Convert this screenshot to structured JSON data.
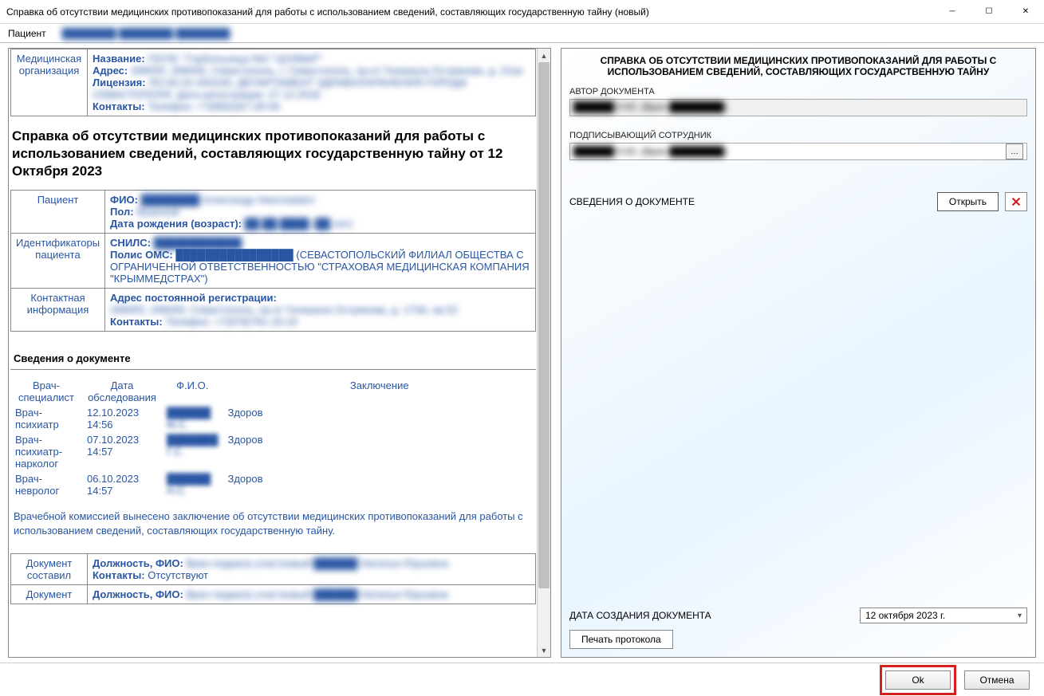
{
  "window": {
    "title": "Справка об отсутствии медицинских противопоказаний для работы с использованием сведений, составляющих государственную тайну (новый)"
  },
  "patient_bar": {
    "label": "Пациент",
    "name": "████████ ████████ ████████"
  },
  "org": {
    "section_label": "Медицинская\nорганизация",
    "name_label": "Название:",
    "name_value": "ГБУЗС \"Горбольница №5 \"ЦОЗМиР\"",
    "addr_label": "Адрес:",
    "addr_value": "299055, 299000, Севастополь, г. Севастополь, пр-кт Генерала Острякова, д. 211в",
    "lic_label": "Лицензия:",
    "lic_value": "ЛО-92-01-000160, ДЕПАРТАМЕНТ ЗДРАВООХРАНЕНИЯ ГОРОДА СЕВАСТОПОЛЯ. Дата регистрации: 27.12.2018",
    "cont_label": "Контакты:",
    "cont_value": "Телефон: +7(8692)67-29-56"
  },
  "doctitle": "Справка об отсутствии медицинских противопоказаний для работы с использованием сведений, составляющих государственную тайну от 12 Октября 2023",
  "patient": {
    "section_label": "Пациент",
    "fio_label": "ФИО:",
    "fio_value": "████████ Александр Николаевич",
    "sex_label": "Пол:",
    "sex_value": "Мужской",
    "dob_label": "Дата рождения (возраст):",
    "dob_value": "██.██.████ (██ лет)"
  },
  "ids": {
    "section_label": "Идентификаторы\nпациента",
    "snils_label": "СНИЛС:",
    "snils_value": "████████████",
    "polis_label": "Полис ОМС:",
    "polis_value": "████████████████ (СЕВАСТОПОЛЬСКИЙ ФИЛИАЛ ОБЩЕСТВА С ОГРАНИЧЕННОЙ ОТВЕТСТВЕННОСТЬЮ \"СТРАХОВАЯ МЕДИЦИНСКАЯ КОМПАНИЯ \"КРЫММЕДСТРАХ\")"
  },
  "contact": {
    "section_label": "Контактная\nинформация",
    "addr_label": "Адрес постоянной регистрации:",
    "addr_value": "299055, 299000, Севастополь, пр-кт Генерала Острякова, д. 173А, кв.52",
    "cont_label": "Контакты:",
    "cont_value": "Телефон: +7(978)791-19-19"
  },
  "docinfo_head": "Сведения о документе",
  "exam": {
    "cols": {
      "c1": "Врач-специалист",
      "c2": "Дата обследования",
      "c3": "Ф.И.О.",
      "c4": "Заключение"
    },
    "rows": [
      {
        "spec": "Врач-психиатр",
        "date": "12.10.2023 14:56",
        "fio": "██████ М.С.",
        "concl": "Здоров"
      },
      {
        "spec": "Врач-психиатр-нарколог",
        "date": "07.10.2023 14:57",
        "fio": "███████ Г.С.",
        "concl": "Здоров"
      },
      {
        "spec": "Врач-невролог",
        "date": "06.10.2023 14:57",
        "fio": "██████ Н.С.",
        "concl": "Здоров"
      }
    ]
  },
  "conclusion": "Врачебной комиссией вынесено заключение об отсутствии медицинских противопоказаний для работы с использованием сведений, составляющих государственную тайну.",
  "composed": {
    "row1_label": "Документ составил",
    "row2_label": "Документ",
    "post_label": "Должность, ФИО:",
    "post_value": "Врач-педиатр участковый  ██████ Наталья Юрьевна",
    "cont_label": "Контакты:",
    "cont_value": "Отсутствуют",
    "post2_value": "Врач-педиатр участковый  ██████ Наталья Юрьевна"
  },
  "right": {
    "heading": "СПРАВКА ОБ ОТСУТСТВИИ МЕДИЦИНСКИХ ПРОТИВОПОКАЗАНИЙ ДЛЯ РАБОТЫ С ИСПОЛЬЗОВАНИЕМ СВЕДЕНИЙ, СОСТАВЛЯЮЩИХ ГОСУДАРСТВЕННУЮ ТАЙНУ",
    "author_label": "АВТОР ДОКУМЕНТА",
    "author_value": "██████ Н.Ю. (Врач-████████)",
    "signer_label": "ПОДПИСЫВАЮЩИЙ СОТРУДНИК",
    "signer_value": "██████ Н.Ю. (Врач-████████)",
    "docinfo_label": "СВЕДЕНИЯ О ДОКУМЕНТЕ",
    "open_btn": "Открыть",
    "date_label": "ДАТА СОЗДАНИЯ ДОКУМЕНТА",
    "date_value": "12  октября  2023 г.",
    "proto_btn": "Печать протокола"
  },
  "footer": {
    "ok": "Ok",
    "cancel": "Отмена"
  }
}
